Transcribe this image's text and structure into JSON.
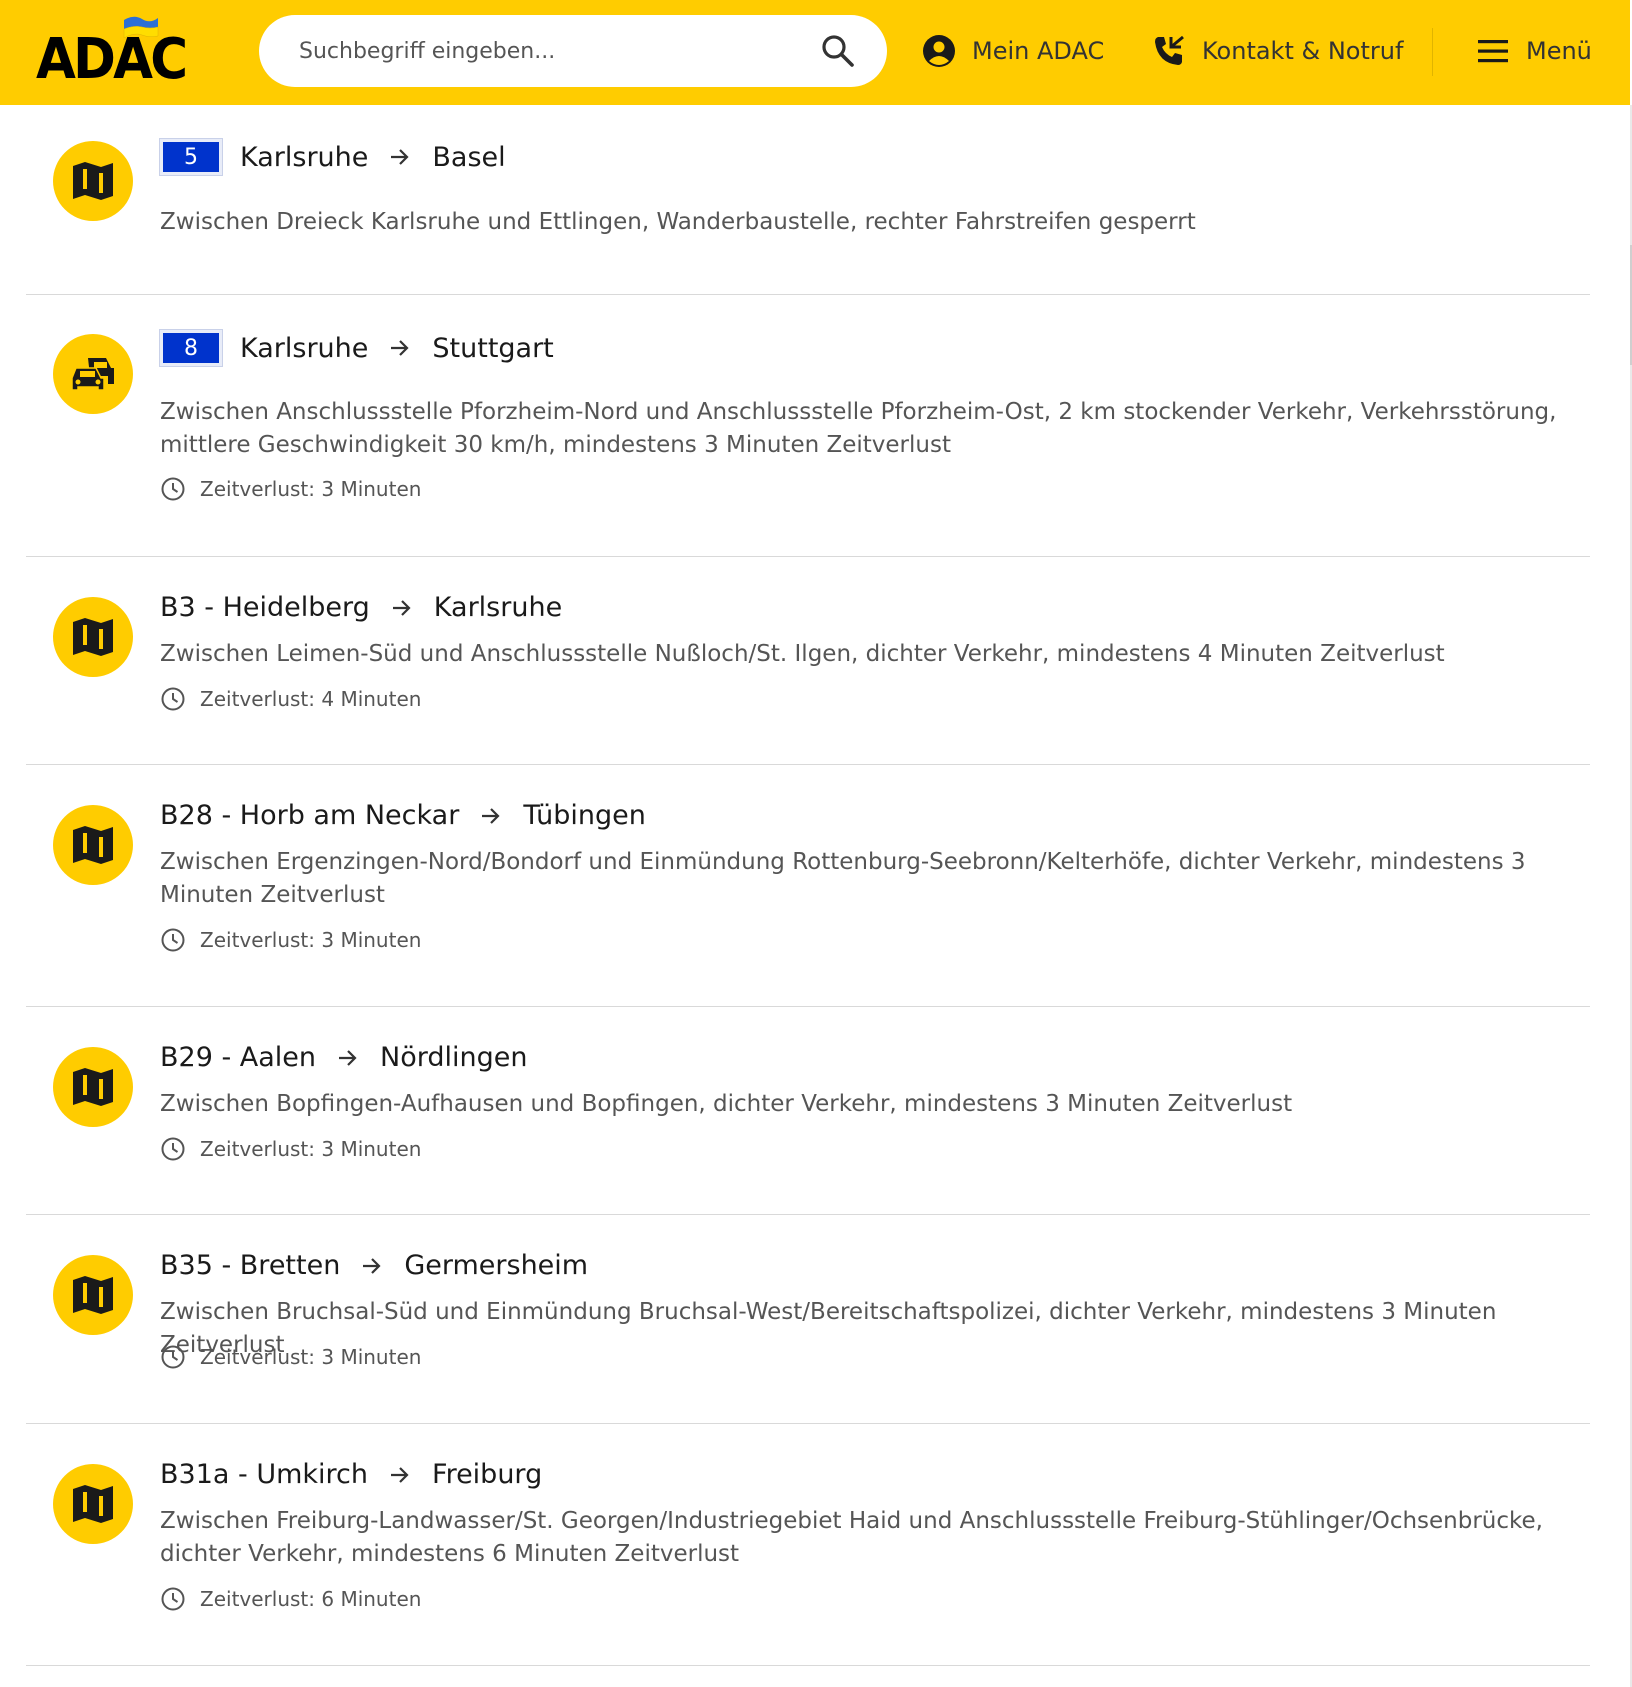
{
  "header": {
    "logo_text": "ADAC",
    "search_placeholder": "Suchbegriff eingeben...",
    "account_label": "Mein ADAC",
    "contact_label": "Kontakt & Notruf",
    "menu_label": "Menü",
    "brand_color": "#ffcc00",
    "icons": [
      "search-icon",
      "user-icon",
      "phone-icon",
      "menu-icon"
    ]
  },
  "items": [
    {
      "icon": "map-icon",
      "road": "",
      "badge": "5",
      "from": "Karlsruhe",
      "to": "Basel",
      "description": "Zwischen Dreieck Karlsruhe und Ettlingen, Wanderbaustelle, rechter Fahrstreifen gesperrt",
      "loss": ""
    },
    {
      "icon": "traffic-jam-icon",
      "road": "",
      "badge": "8",
      "from": "Karlsruhe",
      "to": "Stuttgart",
      "description": "Zwischen Anschlussstelle Pforzheim-Nord und Anschlussstelle Pforzheim-Ost, 2 km stockender Verkehr, Verkehrsstörung, mittlere Geschwindigkeit 30 km/h, mindestens 3 Minuten Zeitverlust",
      "loss": "Zeitverlust: 3 Minuten"
    },
    {
      "icon": "map-icon",
      "road": "B3 - Heidelberg",
      "badge": "",
      "from": "",
      "to": "Karlsruhe",
      "description": "Zwischen Leimen-Süd und Anschlussstelle Nußloch/St. Ilgen, dichter Verkehr, mindestens 4 Minuten Zeitverlust",
      "loss": "Zeitverlust: 4 Minuten"
    },
    {
      "icon": "map-icon",
      "road": "B28 - Horb am Neckar",
      "badge": "",
      "from": "",
      "to": "Tübingen",
      "description": "Zwischen Ergenzingen-Nord/Bondorf und Einmündung Rottenburg-Seebronn/Kelterhöfe, dichter Verkehr, mindestens 3 Minuten Zeitverlust",
      "loss": "Zeitverlust: 3 Minuten"
    },
    {
      "icon": "map-icon",
      "road": "B29 - Aalen",
      "badge": "",
      "from": "",
      "to": "Nördlingen",
      "description": "Zwischen Bopfingen-Aufhausen und Bopfingen, dichter Verkehr, mindestens 3 Minuten Zeitverlust",
      "loss": "Zeitverlust: 3 Minuten"
    },
    {
      "icon": "map-icon",
      "road": "B35 - Bretten",
      "badge": "",
      "from": "",
      "to": "Germersheim",
      "description": "Zwischen Bruchsal-Süd und Einmündung Bruchsal-West/Bereitschaftspolizei, dichter Verkehr, mindestens 3 Minuten Zeitverlust",
      "loss": "Zeitverlust: 3 Minuten"
    },
    {
      "icon": "map-icon",
      "road": "B31a - Umkirch",
      "badge": "",
      "from": "",
      "to": "Freiburg",
      "description": "Zwischen Freiburg-Landwasser/St. Georgen/Industriegebiet Haid und Anschlussstelle Freiburg-Stühlinger/Ochsenbrücke, dichter Verkehr, mindestens 6 Minuten Zeitverlust",
      "loss": "Zeitverlust: 6 Minuten"
    }
  ]
}
